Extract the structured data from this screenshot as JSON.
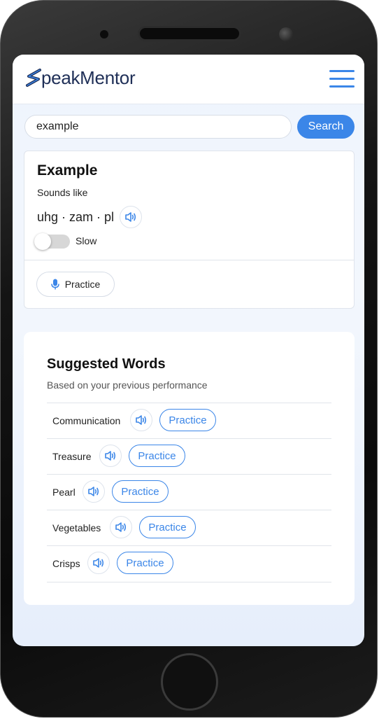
{
  "app": {
    "logo_text": "peakMentor",
    "accent": "#3b86e8",
    "brand_color": "#1f2f57"
  },
  "header": {
    "menu_icon": "hamburger-icon"
  },
  "search": {
    "value": "example",
    "button_label": "Search"
  },
  "word_card": {
    "title": "Example",
    "sounds_like_label": "Sounds like",
    "phonetic": "uhg · zam · pl",
    "speaker_icon": "speaker-icon",
    "slow_label": "Slow",
    "slow_enabled": false,
    "practice_label": "Practice",
    "practice_icon": "microphone-icon"
  },
  "suggested": {
    "title": "Suggested Words",
    "subtitle": "Based on your previous performance",
    "items": [
      {
        "word": "Communication",
        "practice_label": "Practice"
      },
      {
        "word": "Treasure",
        "practice_label": "Practice"
      },
      {
        "word": "Pearl",
        "practice_label": "Practice"
      },
      {
        "word": "Vegetables",
        "practice_label": "Practice"
      },
      {
        "word": "Crisps",
        "practice_label": "Practice"
      }
    ]
  }
}
